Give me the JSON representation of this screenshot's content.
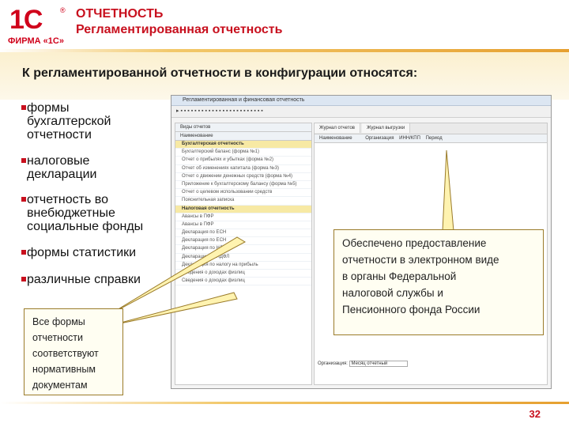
{
  "header": {
    "logo_text": "1С",
    "logo_firm": "ФИРМА «1С»",
    "title": "ОТЧЕТНОСТЬ",
    "subtitle": "Регламентированная отчетность"
  },
  "intro": "К регламентированной отчетности в конфигурации относятся:",
  "bullets": [
    {
      "line1": "формы",
      "line2": "бухгалтерской",
      "line3": "отчетности"
    },
    {
      "line1": "налоговые",
      "line2": "декларации"
    },
    {
      "line1": "отчетность во",
      "line2": "внебюджетные",
      "line3": "социальные фонды"
    },
    {
      "line1": "формы статистики"
    },
    {
      "line1": "различные справки"
    }
  ],
  "window": {
    "title": "Регламентированная и финансовая отчетность",
    "left_panel_title": "Виды отчетов",
    "left_col": "Наименование",
    "tree": [
      {
        "label": "Бухгалтерская отчетность",
        "group": true
      },
      {
        "label": "Бухгалтерский баланс (форма №1)",
        "group": false
      },
      {
        "label": "Отчет о прибылях и убытках (форма №2)",
        "group": false
      },
      {
        "label": "Отчет об изменениях капитала (форма №3)",
        "group": false
      },
      {
        "label": "Отчет о движении денежных средств (форма №4)",
        "group": false
      },
      {
        "label": "Приложение к бухгалтерскому балансу (форма №5)",
        "group": false
      },
      {
        "label": "Отчет о целевом использовании средств",
        "group": false
      },
      {
        "label": "Пояснительная записка",
        "group": false
      },
      {
        "label": "Налоговая отчетность",
        "group": true
      },
      {
        "label": "Авансы в ПФР",
        "group": false
      },
      {
        "label": "Авансы в ПФР",
        "group": false
      },
      {
        "label": "Декларация по ЕСН",
        "group": false
      },
      {
        "label": "Декларация по ЕСН",
        "group": false
      },
      {
        "label": "Декларация по НДС",
        "group": false
      },
      {
        "label": "Декларация по НДФЛ",
        "group": false
      },
      {
        "label": "Декларация по налогу на прибыль",
        "group": false
      },
      {
        "label": "Сведения о доходах физлиц",
        "group": false
      },
      {
        "label": "Сведения о доходах физлиц",
        "group": false
      }
    ],
    "right_tabs": [
      "Журнал отчетов",
      "Журнал выгрузки"
    ],
    "right_cols": [
      "Наименование",
      "Организация",
      "ИНН/КПП",
      "Период"
    ],
    "bottom_label": "Организация:",
    "bottom_value": "Месяц отчетный"
  },
  "callout_left": [
    "Все формы",
    "отчетности",
    "соответствуют",
    "нормативным",
    "документам"
  ],
  "callout_right": [
    "Обеспечено предоставление",
    "отчетности в электронном виде",
    "в органы Федеральной",
    "налоговой службы и",
    "Пенсионного фонда России"
  ],
  "page_number": "32"
}
